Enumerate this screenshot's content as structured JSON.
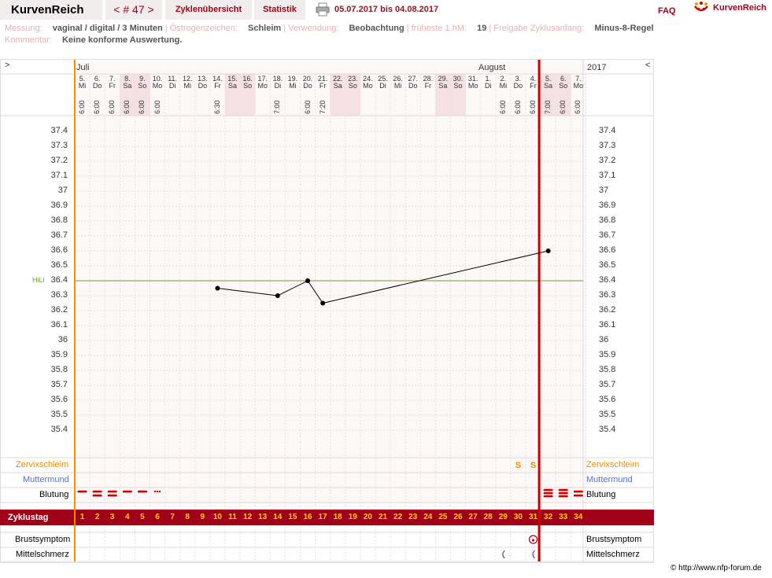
{
  "header": {
    "brand": "KurvenReich",
    "cycle_label": "< # 47 >",
    "tab_overview": "Zyklenübersicht",
    "tab_stats": "Statistik",
    "date_range": "05.07.2017 bis 04.08.2017",
    "faq": "FAQ",
    "logo_text": "KurvenReich"
  },
  "info": {
    "messung_label": "Messung:",
    "messung_value": "vaginal / digital / 3 Minuten",
    "oestrogen_label": "Östrogenzeichen:",
    "oestrogen_value": "Schleim",
    "verwendung_label": "Verwendung:",
    "verwendung_value": "Beobachtung",
    "fruehste_label": "früheste 1.hM:",
    "fruehste_value": "19",
    "freigabe_label": "Freigabe Zyklusanfang:",
    "freigabe_value": "Minus-8-Regel",
    "kommentar_label": "Kommentar:",
    "kommentar_value": "Keine konforme Auswertung.",
    "separator": "|"
  },
  "chart_header": {
    "nav_prev": ">",
    "nav_next": "<",
    "month_july": "Juli",
    "month_august": "August",
    "year": "2017"
  },
  "days": [
    {
      "date": "5.",
      "wd": "Mi",
      "time": "6:00",
      "we": false
    },
    {
      "date": "6.",
      "wd": "Do",
      "time": "6:00",
      "we": false
    },
    {
      "date": "7.",
      "wd": "Fr",
      "time": "6:00",
      "we": false
    },
    {
      "date": "8.",
      "wd": "Sa",
      "time": "6:00",
      "we": true
    },
    {
      "date": "9.",
      "wd": "So",
      "time": "6:00",
      "we": true
    },
    {
      "date": "10.",
      "wd": "Mo",
      "time": "6:00",
      "we": false
    },
    {
      "date": "11.",
      "wd": "Di",
      "time": "",
      "we": false
    },
    {
      "date": "12.",
      "wd": "Mi",
      "time": "",
      "we": false
    },
    {
      "date": "13.",
      "wd": "Do",
      "time": "",
      "we": false
    },
    {
      "date": "14.",
      "wd": "Fr",
      "time": "6:30",
      "we": false
    },
    {
      "date": "15.",
      "wd": "Sa",
      "time": "",
      "we": true
    },
    {
      "date": "16.",
      "wd": "So",
      "time": "",
      "we": true
    },
    {
      "date": "17.",
      "wd": "Mo",
      "time": "",
      "we": false
    },
    {
      "date": "18.",
      "wd": "Di",
      "time": "7:00",
      "we": false
    },
    {
      "date": "19.",
      "wd": "Mi",
      "time": "",
      "we": false
    },
    {
      "date": "20.",
      "wd": "Do",
      "time": "6:00",
      "we": false
    },
    {
      "date": "21.",
      "wd": "Fr",
      "time": "7:20",
      "we": false
    },
    {
      "date": "22.",
      "wd": "Sa",
      "time": "",
      "we": true
    },
    {
      "date": "23.",
      "wd": "So",
      "time": "",
      "we": true
    },
    {
      "date": "24.",
      "wd": "Mo",
      "time": "",
      "we": false
    },
    {
      "date": "25.",
      "wd": "Di",
      "time": "",
      "we": false
    },
    {
      "date": "26.",
      "wd": "Mi",
      "time": "",
      "we": false
    },
    {
      "date": "27.",
      "wd": "Do",
      "time": "",
      "we": false
    },
    {
      "date": "28.",
      "wd": "Fr",
      "time": "",
      "we": false
    },
    {
      "date": "29.",
      "wd": "Sa",
      "time": "",
      "we": true
    },
    {
      "date": "30.",
      "wd": "So",
      "time": "",
      "we": true
    },
    {
      "date": "31.",
      "wd": "Mo",
      "time": "",
      "we": false
    },
    {
      "date": "1.",
      "wd": "Di",
      "time": "",
      "we": false
    },
    {
      "date": "2.",
      "wd": "Mi",
      "time": "6:00",
      "we": false
    },
    {
      "date": "3.",
      "wd": "Do",
      "time": "6:00",
      "we": false
    },
    {
      "date": "4.",
      "wd": "Fr",
      "time": "6:00",
      "we": false
    },
    {
      "date": "5.",
      "wd": "Sa",
      "time": "7:00",
      "we": true
    },
    {
      "date": "6.",
      "wd": "So",
      "time": "6:00",
      "we": true
    },
    {
      "date": "7.",
      "wd": "Mo",
      "time": "6:00",
      "we": false
    }
  ],
  "temp_scale": [
    "37.4",
    "37.3",
    "37.2",
    "37.1",
    "37",
    "36.9",
    "36.8",
    "36.7",
    "36.6",
    "36.5",
    "36.4",
    "36.3",
    "36.2",
    "36.1",
    "36",
    "35.9",
    "35.8",
    "35.7",
    "35.6",
    "35.5",
    "35.4"
  ],
  "hili_label": "HiLi",
  "rows": {
    "zervixschleim": "Zervixschleim",
    "muttermund": "Muttermund",
    "blutung": "Blutung",
    "zyklustag": "Zyklustag",
    "brustsymptom": "Brustsymptom",
    "mittelschmerz": "Mittelschmerz"
  },
  "zervix_marks": [
    {
      "day": 29,
      "symbol": "S"
    },
    {
      "day": 30,
      "symbol": "S"
    }
  ],
  "bleeding": [
    {
      "day": 0,
      "level": "light"
    },
    {
      "day": 1,
      "level": "heavy"
    },
    {
      "day": 2,
      "level": "heavy"
    },
    {
      "day": 3,
      "level": "light"
    },
    {
      "day": 4,
      "level": "light"
    },
    {
      "day": 5,
      "level": "spot"
    },
    {
      "day": 31,
      "level": "veryheavy"
    },
    {
      "day": 32,
      "level": "veryheavy"
    },
    {
      "day": 33,
      "level": "heavy"
    }
  ],
  "cycle_days": [
    "1",
    "2",
    "3",
    "4",
    "5",
    "6",
    "7",
    "8",
    "9",
    "10",
    "11",
    "12",
    "13",
    "14",
    "15",
    "16",
    "17",
    "18",
    "19",
    "20",
    "21",
    "22",
    "23",
    "24",
    "25",
    "26",
    "27",
    "28",
    "29",
    "30",
    "31",
    "32",
    "33",
    "34"
  ],
  "footer": "© http://www.nfp-forum.de",
  "colors": {
    "accent": "#a00018",
    "cycle_start": "#ff8c00",
    "cycle_end": "#cc0000",
    "hili": "#6a9a3a"
  },
  "chart_data": {
    "type": "line",
    "ylabel": "",
    "ylim": [
      35.4,
      37.4
    ],
    "hili": 36.4,
    "points": [
      {
        "day": "14.",
        "value": 36.35
      },
      {
        "day": "18.",
        "value": 36.3
      },
      {
        "day": "20.",
        "value": 36.4
      },
      {
        "day": "21.",
        "value": 36.25
      },
      {
        "day": "5.",
        "value": 36.6
      }
    ],
    "point_day_index": [
      9,
      13,
      15,
      16,
      31
    ]
  }
}
